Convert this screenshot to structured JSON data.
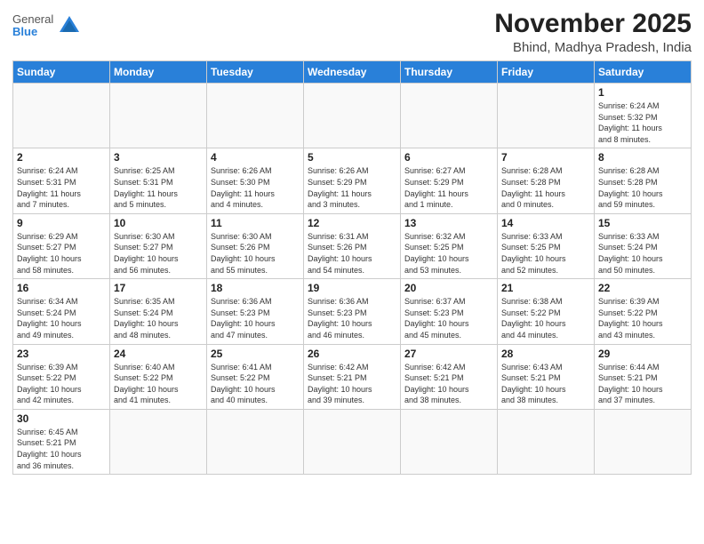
{
  "header": {
    "logo": {
      "general": "General",
      "blue": "Blue"
    },
    "month": "November 2025",
    "location": "Bhind, Madhya Pradesh, India"
  },
  "weekdays": [
    "Sunday",
    "Monday",
    "Tuesday",
    "Wednesday",
    "Thursday",
    "Friday",
    "Saturday"
  ],
  "weeks": [
    [
      {
        "day": "",
        "info": ""
      },
      {
        "day": "",
        "info": ""
      },
      {
        "day": "",
        "info": ""
      },
      {
        "day": "",
        "info": ""
      },
      {
        "day": "",
        "info": ""
      },
      {
        "day": "",
        "info": ""
      },
      {
        "day": "1",
        "info": "Sunrise: 6:24 AM\nSunset: 5:32 PM\nDaylight: 11 hours\nand 8 minutes."
      }
    ],
    [
      {
        "day": "2",
        "info": "Sunrise: 6:24 AM\nSunset: 5:31 PM\nDaylight: 11 hours\nand 7 minutes."
      },
      {
        "day": "3",
        "info": "Sunrise: 6:25 AM\nSunset: 5:31 PM\nDaylight: 11 hours\nand 5 minutes."
      },
      {
        "day": "4",
        "info": "Sunrise: 6:26 AM\nSunset: 5:30 PM\nDaylight: 11 hours\nand 4 minutes."
      },
      {
        "day": "5",
        "info": "Sunrise: 6:26 AM\nSunset: 5:29 PM\nDaylight: 11 hours\nand 3 minutes."
      },
      {
        "day": "6",
        "info": "Sunrise: 6:27 AM\nSunset: 5:29 PM\nDaylight: 11 hours\nand 1 minute."
      },
      {
        "day": "7",
        "info": "Sunrise: 6:28 AM\nSunset: 5:28 PM\nDaylight: 11 hours\nand 0 minutes."
      },
      {
        "day": "8",
        "info": "Sunrise: 6:28 AM\nSunset: 5:28 PM\nDaylight: 10 hours\nand 59 minutes."
      }
    ],
    [
      {
        "day": "9",
        "info": "Sunrise: 6:29 AM\nSunset: 5:27 PM\nDaylight: 10 hours\nand 58 minutes."
      },
      {
        "day": "10",
        "info": "Sunrise: 6:30 AM\nSunset: 5:27 PM\nDaylight: 10 hours\nand 56 minutes."
      },
      {
        "day": "11",
        "info": "Sunrise: 6:30 AM\nSunset: 5:26 PM\nDaylight: 10 hours\nand 55 minutes."
      },
      {
        "day": "12",
        "info": "Sunrise: 6:31 AM\nSunset: 5:26 PM\nDaylight: 10 hours\nand 54 minutes."
      },
      {
        "day": "13",
        "info": "Sunrise: 6:32 AM\nSunset: 5:25 PM\nDaylight: 10 hours\nand 53 minutes."
      },
      {
        "day": "14",
        "info": "Sunrise: 6:33 AM\nSunset: 5:25 PM\nDaylight: 10 hours\nand 52 minutes."
      },
      {
        "day": "15",
        "info": "Sunrise: 6:33 AM\nSunset: 5:24 PM\nDaylight: 10 hours\nand 50 minutes."
      }
    ],
    [
      {
        "day": "16",
        "info": "Sunrise: 6:34 AM\nSunset: 5:24 PM\nDaylight: 10 hours\nand 49 minutes."
      },
      {
        "day": "17",
        "info": "Sunrise: 6:35 AM\nSunset: 5:24 PM\nDaylight: 10 hours\nand 48 minutes."
      },
      {
        "day": "18",
        "info": "Sunrise: 6:36 AM\nSunset: 5:23 PM\nDaylight: 10 hours\nand 47 minutes."
      },
      {
        "day": "19",
        "info": "Sunrise: 6:36 AM\nSunset: 5:23 PM\nDaylight: 10 hours\nand 46 minutes."
      },
      {
        "day": "20",
        "info": "Sunrise: 6:37 AM\nSunset: 5:23 PM\nDaylight: 10 hours\nand 45 minutes."
      },
      {
        "day": "21",
        "info": "Sunrise: 6:38 AM\nSunset: 5:22 PM\nDaylight: 10 hours\nand 44 minutes."
      },
      {
        "day": "22",
        "info": "Sunrise: 6:39 AM\nSunset: 5:22 PM\nDaylight: 10 hours\nand 43 minutes."
      }
    ],
    [
      {
        "day": "23",
        "info": "Sunrise: 6:39 AM\nSunset: 5:22 PM\nDaylight: 10 hours\nand 42 minutes."
      },
      {
        "day": "24",
        "info": "Sunrise: 6:40 AM\nSunset: 5:22 PM\nDaylight: 10 hours\nand 41 minutes."
      },
      {
        "day": "25",
        "info": "Sunrise: 6:41 AM\nSunset: 5:22 PM\nDaylight: 10 hours\nand 40 minutes."
      },
      {
        "day": "26",
        "info": "Sunrise: 6:42 AM\nSunset: 5:21 PM\nDaylight: 10 hours\nand 39 minutes."
      },
      {
        "day": "27",
        "info": "Sunrise: 6:42 AM\nSunset: 5:21 PM\nDaylight: 10 hours\nand 38 minutes."
      },
      {
        "day": "28",
        "info": "Sunrise: 6:43 AM\nSunset: 5:21 PM\nDaylight: 10 hours\nand 38 minutes."
      },
      {
        "day": "29",
        "info": "Sunrise: 6:44 AM\nSunset: 5:21 PM\nDaylight: 10 hours\nand 37 minutes."
      }
    ],
    [
      {
        "day": "30",
        "info": "Sunrise: 6:45 AM\nSunset: 5:21 PM\nDaylight: 10 hours\nand 36 minutes."
      },
      {
        "day": "",
        "info": ""
      },
      {
        "day": "",
        "info": ""
      },
      {
        "day": "",
        "info": ""
      },
      {
        "day": "",
        "info": ""
      },
      {
        "day": "",
        "info": ""
      },
      {
        "day": "",
        "info": ""
      }
    ]
  ]
}
